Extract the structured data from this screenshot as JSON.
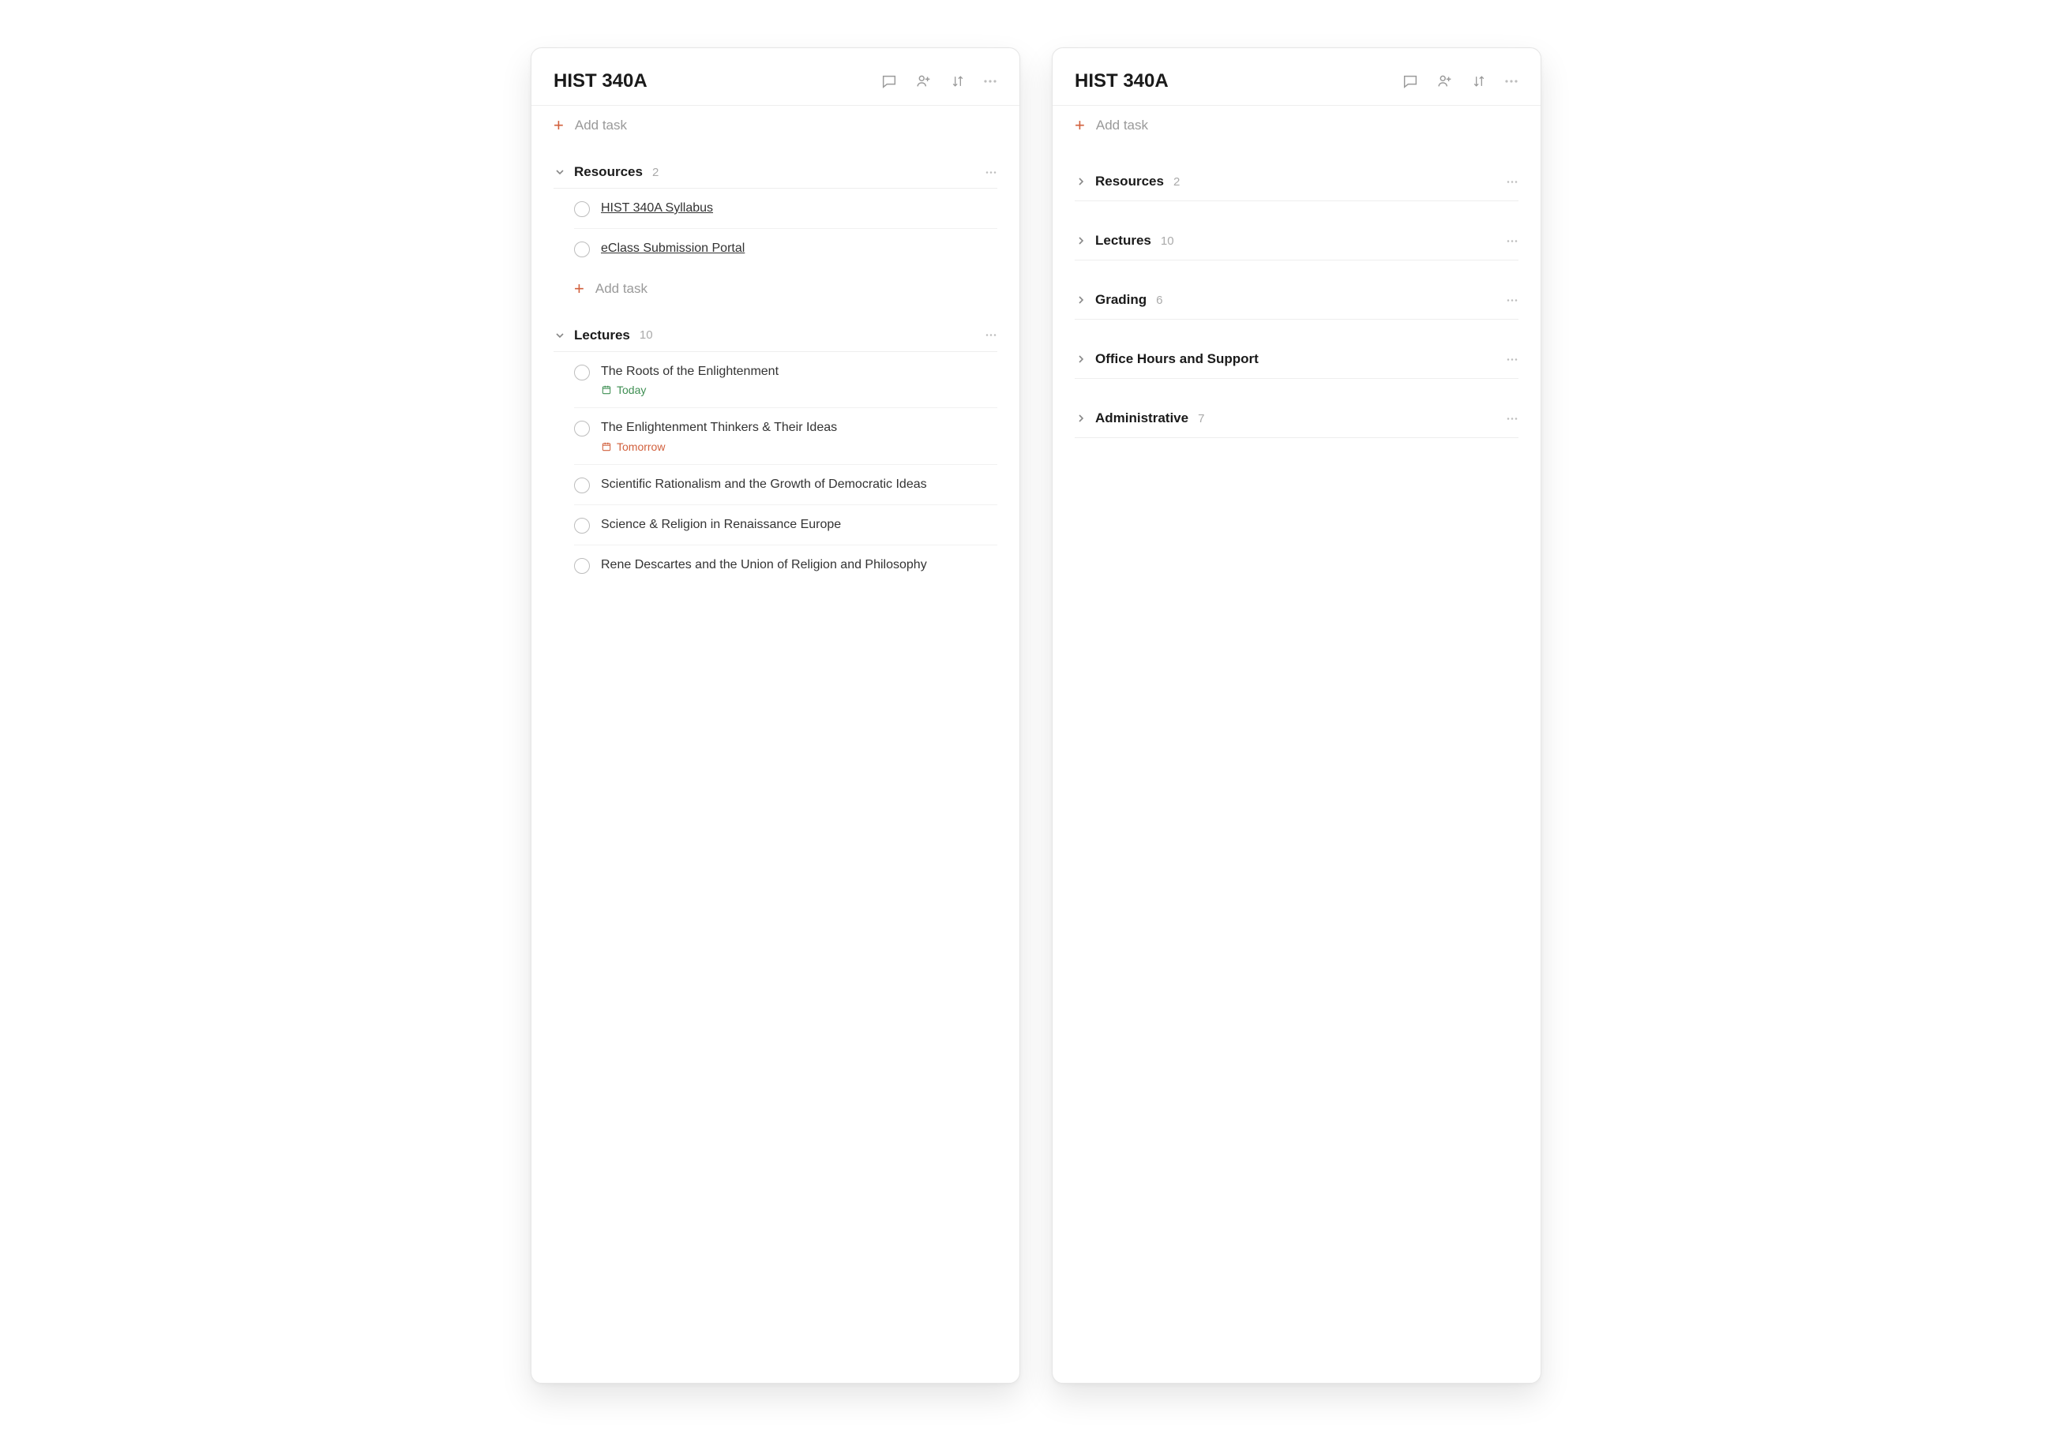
{
  "left": {
    "title": "HIST 340A",
    "addTask": "Add task",
    "sections": [
      {
        "name": "Resources",
        "count": "2",
        "expanded": true,
        "tasks": [
          {
            "title": "HIST 340A Syllabus",
            "link": true
          },
          {
            "title": "eClass Submission Portal",
            "link": true
          }
        ],
        "showAddTask": true
      },
      {
        "name": "Lectures",
        "count": "10",
        "expanded": true,
        "tasks": [
          {
            "title": "The Roots of the Enlightenment",
            "due": "Today",
            "dueClass": "today"
          },
          {
            "title": "The Enlightenment Thinkers & Their Ideas",
            "due": "Tomorrow",
            "dueClass": "tomorrow"
          },
          {
            "title": "Scientific Rationalism and the Growth of Democratic Ideas"
          },
          {
            "title": "Science & Religion in Renaissance Europe"
          },
          {
            "title": "Rene Descartes and the Union of Religion and Philosophy"
          }
        ]
      }
    ]
  },
  "right": {
    "title": "HIST 340A",
    "addTask": "Add task",
    "sections": [
      {
        "name": "Resources",
        "count": "2"
      },
      {
        "name": "Lectures",
        "count": "10"
      },
      {
        "name": "Grading",
        "count": "6"
      },
      {
        "name": "Office Hours and Support",
        "count": ""
      },
      {
        "name": "Administrative",
        "count": "7"
      }
    ]
  }
}
